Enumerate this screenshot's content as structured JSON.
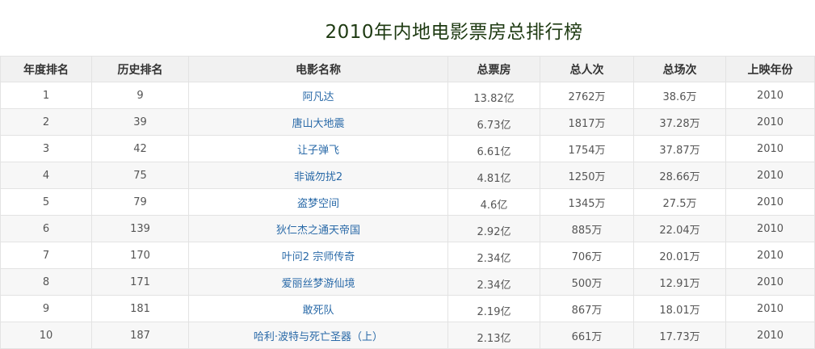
{
  "page": {
    "title": "2010年内地电影票房总排行榜"
  },
  "table": {
    "columns": [
      "年度排名",
      "历史排名",
      "电影名称",
      "总票房",
      "总人次",
      "总场次",
      "上映年份"
    ],
    "rows": [
      {
        "year_rank": "1",
        "history_rank": "9",
        "movie": "阿凡达",
        "box_office": "13.82亿",
        "admissions": "2762万",
        "screenings": "38.6万",
        "year": "2010"
      },
      {
        "year_rank": "2",
        "history_rank": "39",
        "movie": "唐山大地震",
        "box_office": "6.73亿",
        "admissions": "1817万",
        "screenings": "37.28万",
        "year": "2010"
      },
      {
        "year_rank": "3",
        "history_rank": "42",
        "movie": "让子弹飞",
        "box_office": "6.61亿",
        "admissions": "1754万",
        "screenings": "37.87万",
        "year": "2010"
      },
      {
        "year_rank": "4",
        "history_rank": "75",
        "movie": "非诚勿扰2",
        "box_office": "4.81亿",
        "admissions": "1250万",
        "screenings": "28.66万",
        "year": "2010"
      },
      {
        "year_rank": "5",
        "history_rank": "79",
        "movie": "盗梦空间",
        "box_office": "4.6亿",
        "admissions": "1345万",
        "screenings": "27.5万",
        "year": "2010"
      },
      {
        "year_rank": "6",
        "history_rank": "139",
        "movie": "狄仁杰之通天帝国",
        "box_office": "2.92亿",
        "admissions": "885万",
        "screenings": "22.04万",
        "year": "2010"
      },
      {
        "year_rank": "7",
        "history_rank": "170",
        "movie": "叶问2 宗师传奇",
        "box_office": "2.34亿",
        "admissions": "706万",
        "screenings": "20.01万",
        "year": "2010"
      },
      {
        "year_rank": "8",
        "history_rank": "171",
        "movie": "爱丽丝梦游仙境",
        "box_office": "2.34亿",
        "admissions": "500万",
        "screenings": "12.91万",
        "year": "2010"
      },
      {
        "year_rank": "9",
        "history_rank": "181",
        "movie": "敢死队",
        "box_office": "2.19亿",
        "admissions": "867万",
        "screenings": "18.01万",
        "year": "2010"
      },
      {
        "year_rank": "10",
        "history_rank": "187",
        "movie": "哈利·波特与死亡圣器（上）",
        "box_office": "2.13亿",
        "admissions": "661万",
        "screenings": "17.73万",
        "year": "2010"
      }
    ]
  },
  "colors": {
    "title": "#1e3a12",
    "header_bg": "#f1f1f1",
    "row_alt_bg": "#f7f7f7",
    "link": "#2a6aa8",
    "border": "#e3e3e3"
  }
}
